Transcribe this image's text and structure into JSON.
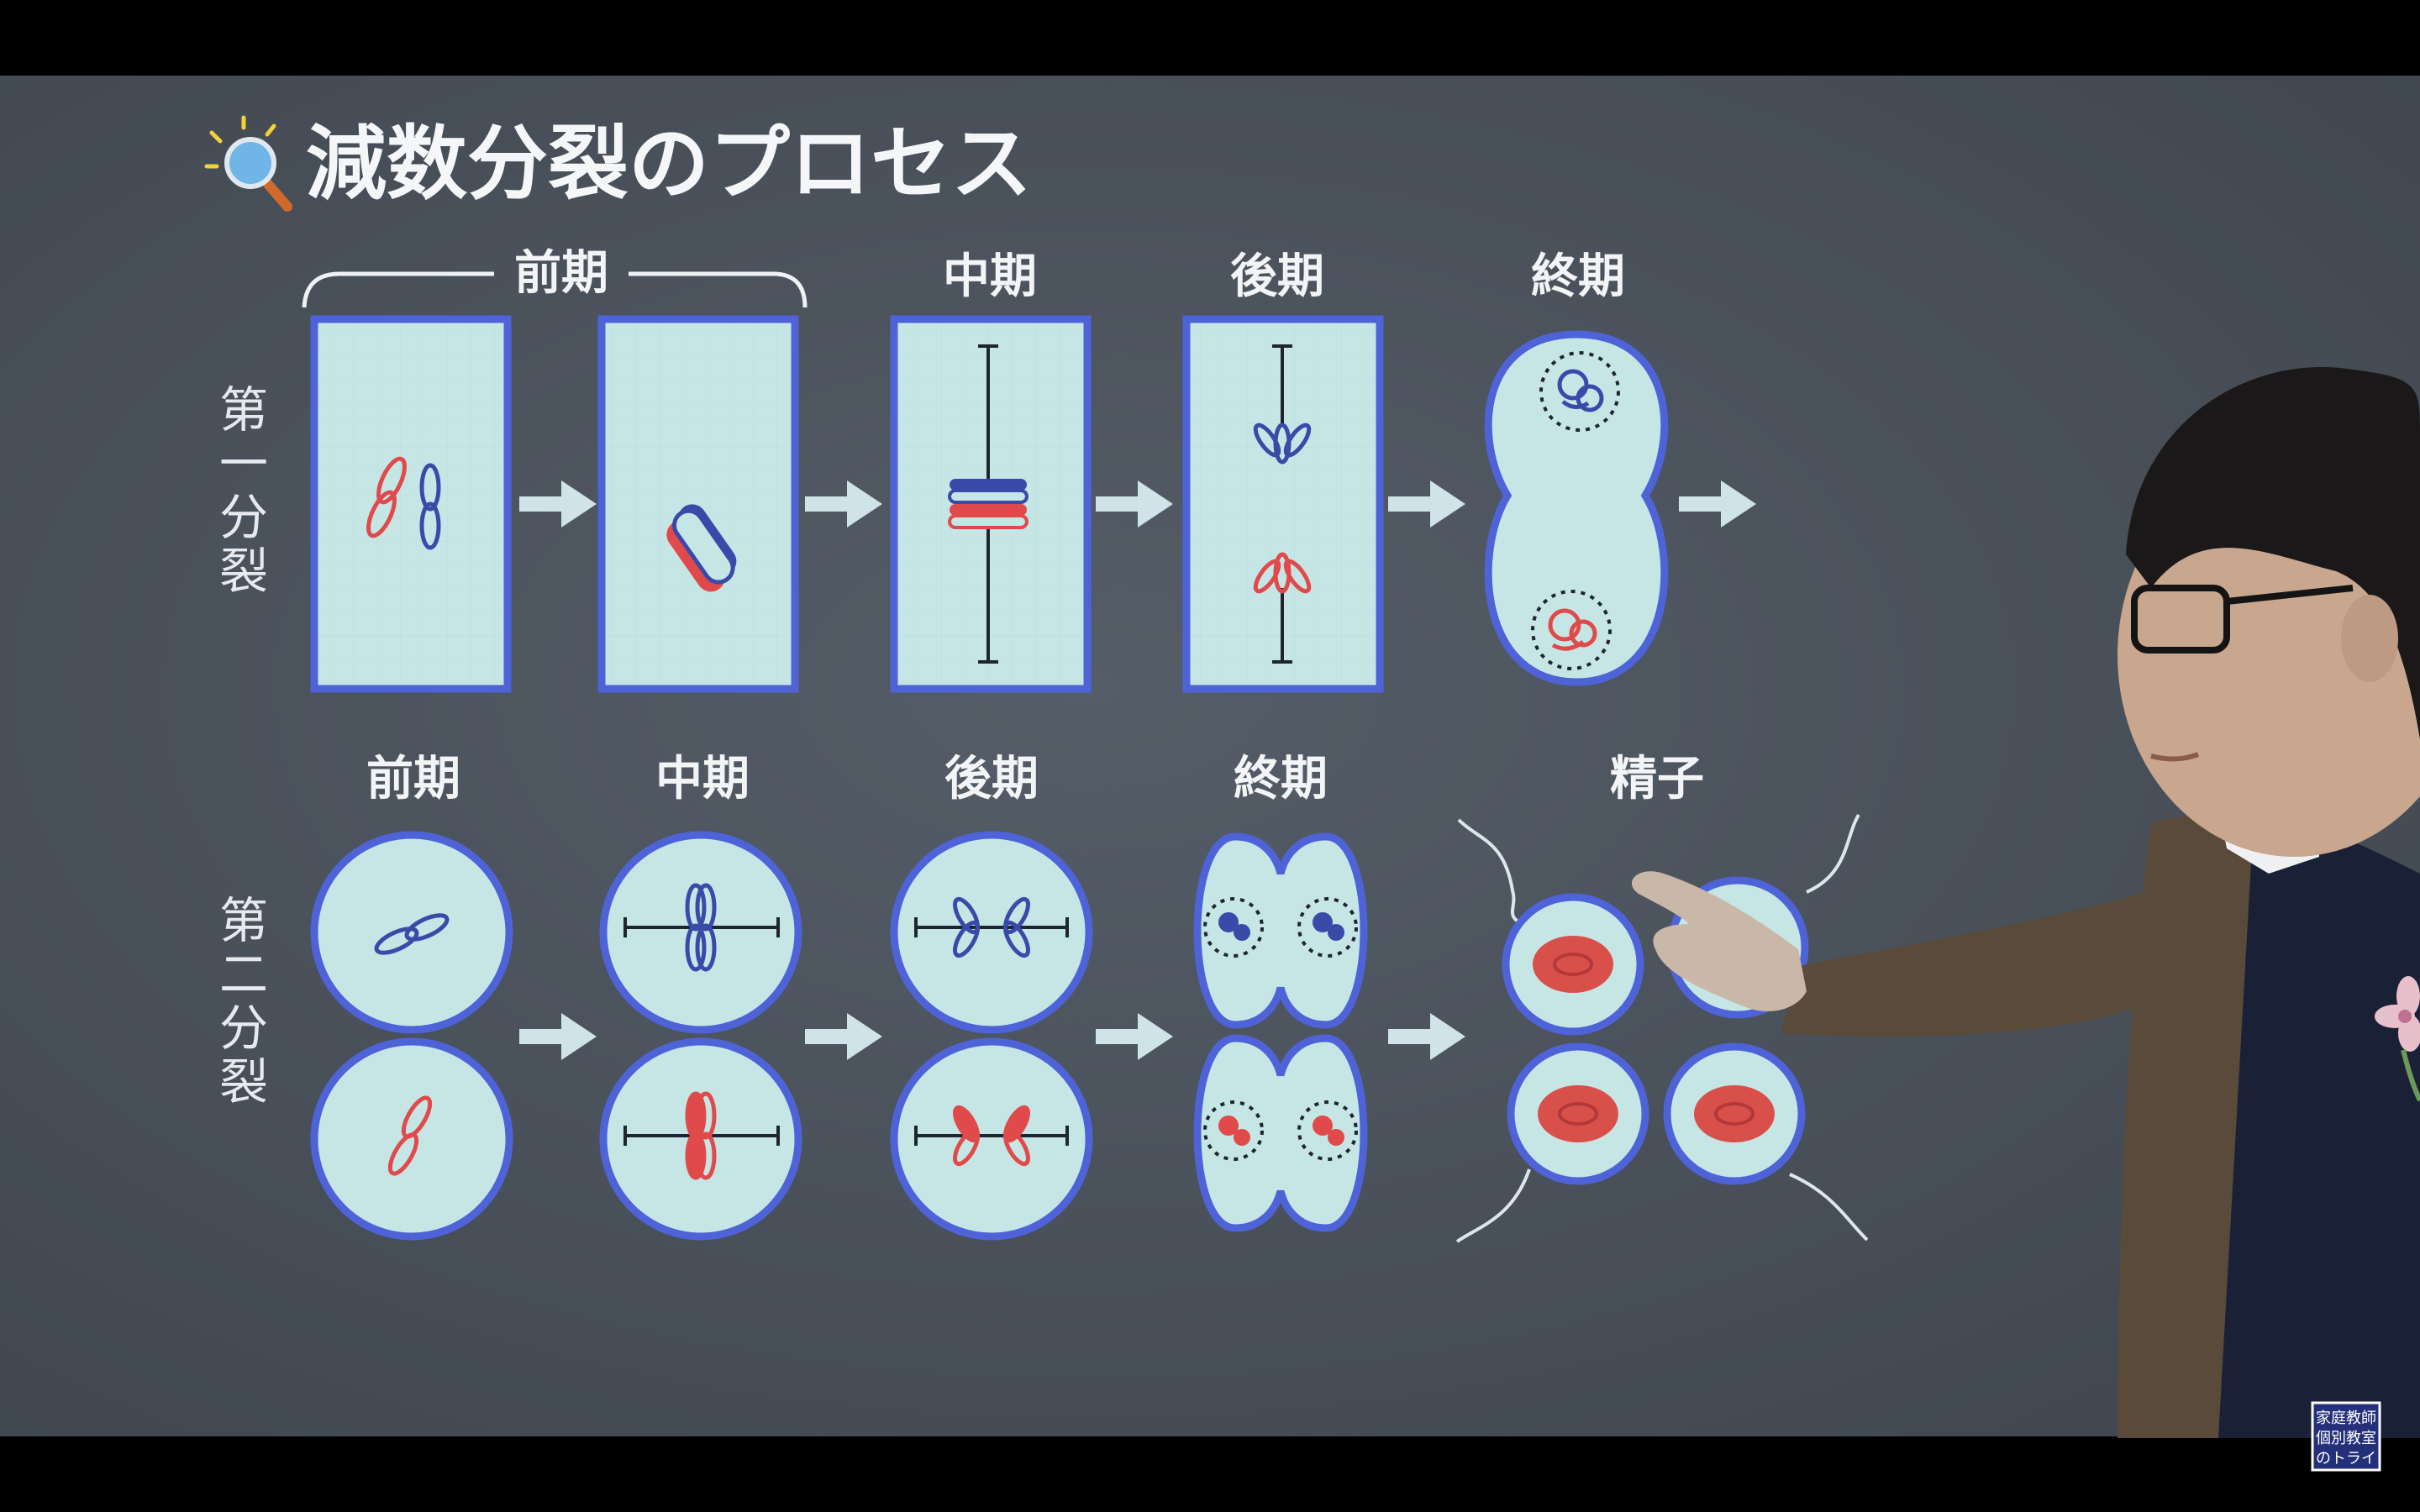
{
  "title": "減数分裂のプロセス",
  "first_division": {
    "side_label": [
      "第",
      "一",
      "分",
      "裂"
    ],
    "stages": {
      "prophase": "前期",
      "metaphase": "中期",
      "anaphase": "後期",
      "telophase": "終期"
    }
  },
  "second_division": {
    "side_label": [
      "第",
      "二",
      "分",
      "裂"
    ],
    "stages": {
      "prophase": "前期",
      "metaphase": "中期",
      "anaphase": "後期",
      "telophase": "終期",
      "result": "精子"
    }
  },
  "logo": {
    "lines": [
      "家庭教師",
      "個別教室",
      "のトライ"
    ]
  },
  "colors": {
    "board": "#4a525c",
    "cell_fill": "#c6e6e6",
    "cell_border": "#4f63d8",
    "red_chromosome": "#e04a4a",
    "blue_chromosome": "#3a4aa8",
    "arrow": "#cfe3e8"
  }
}
